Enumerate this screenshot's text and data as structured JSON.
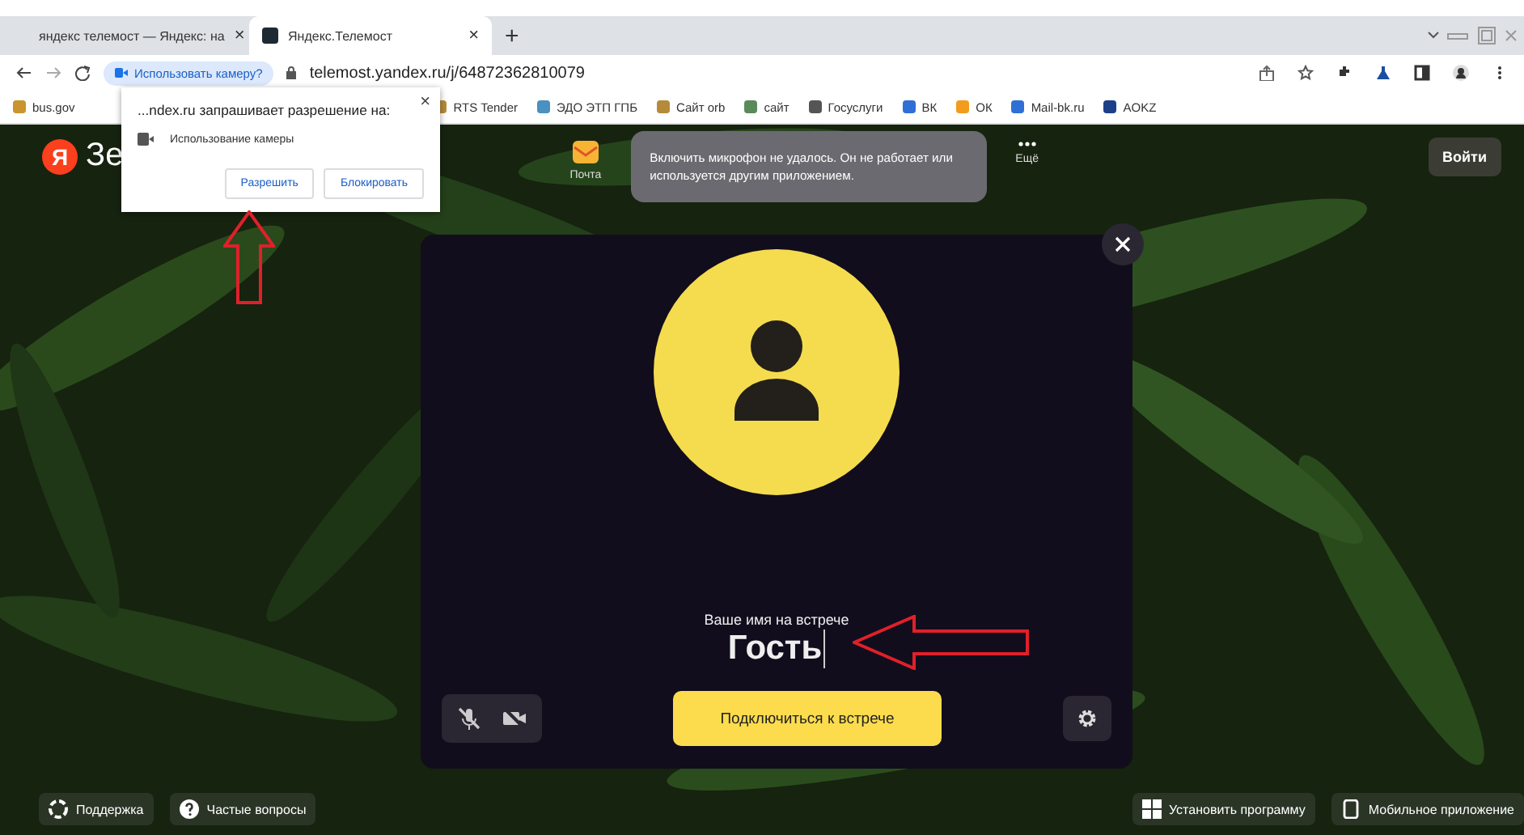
{
  "browser": {
    "tabs": [
      {
        "title": "яндекс телемост — Яндекс: на",
        "close": "×",
        "selected": false
      },
      {
        "title": "Яндекс.Телемост",
        "close": "×",
        "selected": true
      }
    ],
    "new_tab": "+",
    "address_bar": {
      "permission_chip": "Использовать камеру?",
      "url": "telemost.yandex.ru/j/64872362810079"
    },
    "bookmarks": [
      "bus.gov",
      "RTS Tender",
      "ЭДО ЭТП ГПБ",
      "Сайт orb",
      "сайт",
      "Госуслуги",
      "ВК",
      "ОК",
      "Mail-bk.ru",
      "AOKZ"
    ]
  },
  "permission_popup": {
    "title": "...ndex.ru запрашивает разрешение на:",
    "close": "×",
    "permission": "Использование камеры",
    "buttons": [
      "Разрешить",
      "Блокировать"
    ]
  },
  "page": {
    "logo": "Я",
    "logo_text": "Зе",
    "nav": [
      "Почта",
      "Ещё"
    ],
    "login": "Войти",
    "toast": "Включить микрофон не удалось. Он не работает или используется другим приложением.",
    "card": {
      "name_label": "Ваше имя на встрече",
      "name_value": "Гость",
      "microphone_on": false,
      "camera_on": false,
      "join_button": "Подключиться к встрече"
    },
    "footer_left": [
      "Поддержка",
      "Частые вопросы"
    ],
    "footer_right": [
      "Установить программу",
      "Мобильное приложение"
    ]
  }
}
